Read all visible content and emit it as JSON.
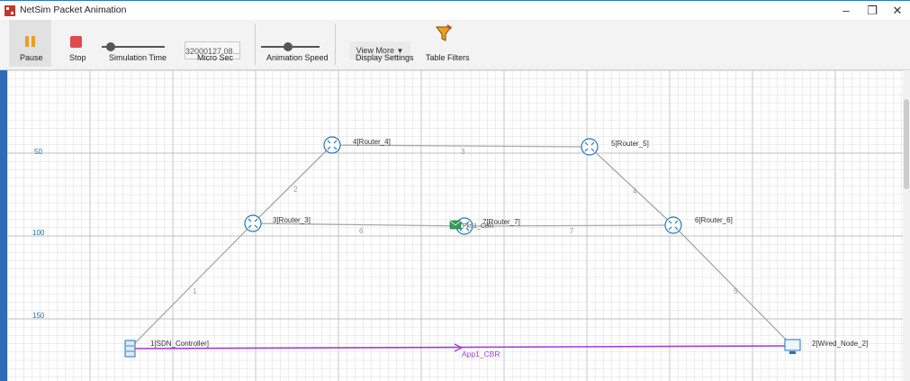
{
  "window": {
    "title": "NetSim Packet Animation",
    "minimize_glyph": "–",
    "maximize_glyph": "❐",
    "close_glyph": "✕"
  },
  "toolbar": {
    "pause_label": "Pause",
    "stop_label": "Stop",
    "sim_time_label": "Simulation Time",
    "micro_sec_value": "32000127.08...",
    "micro_sec_label": "Micro Sec",
    "anim_speed_label": "Animation Speed",
    "view_more_label": "View More",
    "display_settings_label": "Display Settings",
    "table_filters_label": "Table Filters"
  },
  "canvas": {
    "y_ticks": [
      "50",
      "100",
      "150"
    ],
    "nodes": {
      "sdn": "1[SDN_Controller]",
      "wired": "2[Wired_Node_2]",
      "r3": "3[Router_3]",
      "r4": "4[Router_4]",
      "r5": "5[Router_5]",
      "r6": "6[Router_6]",
      "r7": "7[Router_7]"
    },
    "links": {
      "l1": "1",
      "l2": "2",
      "l3": "3",
      "l4": "4",
      "l5": "5",
      "l6": "6",
      "l7": "7"
    },
    "packet_label": "Pkt 1_CBR",
    "app_label": "App1_CBR"
  },
  "colors": {
    "grid": "#dcdcdc",
    "link": "#a8a8a8",
    "router": "#1e73be",
    "app_flow": "#a43bd6",
    "packet": "#2e9e5b"
  }
}
